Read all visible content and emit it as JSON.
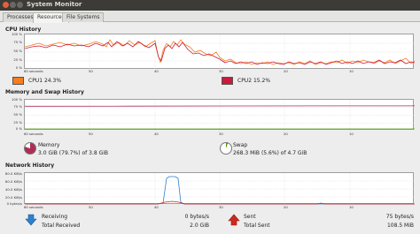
{
  "window": {
    "title": "System Monitor"
  },
  "tabs": [
    {
      "label": "Processes",
      "active": false
    },
    {
      "label": "Resources",
      "active": true
    },
    {
      "label": "File Systems",
      "active": false
    }
  ],
  "cpu": {
    "title": "CPU History",
    "y_ticks": [
      "100 %",
      "75 %",
      "50 %",
      "25 %",
      "0 %"
    ],
    "x_ticks": [
      "60 seconds",
      "50",
      "40",
      "30",
      "20",
      "10"
    ],
    "cpu1": {
      "label": "CPU1",
      "value": "24.3%",
      "color": "#f97d1c"
    },
    "cpu2": {
      "label": "CPU2",
      "value": "15.2%",
      "color": "#cb1b3a"
    }
  },
  "memory": {
    "title": "Memory and Swap History",
    "y_ticks": [
      "100 %",
      "75 %",
      "50 %",
      "25 %",
      "0 %"
    ],
    "x_ticks": [
      "60 seconds",
      "50",
      "40",
      "30",
      "20",
      "10"
    ],
    "memory_label": "Memory",
    "memory_value": "3.0 GiB (79.7%) of 3.8 GiB",
    "memory_fraction": 0.797,
    "memory_color": "#ad2e55",
    "swap_label": "Swap",
    "swap_value": "268.3 MiB (5.6%) of 4.7 GiB",
    "swap_fraction": 0.056,
    "swap_color": "#4e9a06"
  },
  "network": {
    "title": "Network History",
    "y_ticks": [
      "80.0 KiB/s",
      "60.0 KiB/s",
      "40.0 KiB/s",
      "20.0 KiB/s",
      "0 bytes/s"
    ],
    "x_ticks": [
      "60 seconds",
      "50",
      "40",
      "30",
      "20",
      "10"
    ],
    "receiving_label": "Receiving",
    "receiving_value": "0 bytes/s",
    "total_received_label": "Total Received",
    "total_received_value": "2.0 GiB",
    "sent_label": "Sent",
    "sent_value": "75 bytes/s",
    "total_sent_label": "Total Sent",
    "total_sent_value": "108.5 MiB",
    "receiving_color": "#2f7fcf",
    "sent_color": "#cc2a1d"
  }
}
